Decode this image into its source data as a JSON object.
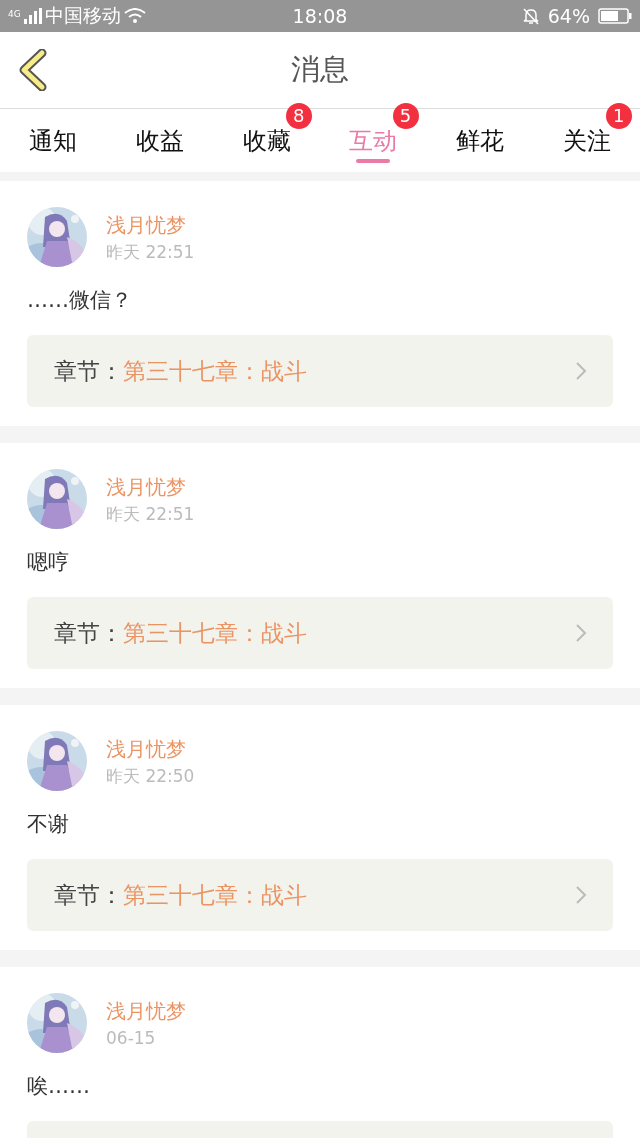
{
  "status_bar": {
    "carrier": "中国移动",
    "network": "4G",
    "time": "18:08",
    "battery": "64%"
  },
  "header": {
    "title": "消息"
  },
  "tabs": [
    {
      "label": "通知",
      "selected": false
    },
    {
      "label": "收益",
      "selected": false
    },
    {
      "label": "收藏",
      "selected": false,
      "badge": "8"
    },
    {
      "label": "互动",
      "selected": true,
      "badge": "5"
    },
    {
      "label": "鲜花",
      "selected": false
    },
    {
      "label": "关注",
      "selected": false,
      "badge": "1"
    }
  ],
  "messages": [
    {
      "user": "浅月忧梦",
      "time": "昨天 22:51",
      "text": "……微信？",
      "chapter_label": "章节：",
      "chapter": "第三十七章：战斗"
    },
    {
      "user": "浅月忧梦",
      "time": "昨天 22:51",
      "text": "嗯哼",
      "chapter_label": "章节：",
      "chapter": "第三十七章：战斗"
    },
    {
      "user": "浅月忧梦",
      "time": "昨天 22:50",
      "text": "不谢",
      "chapter_label": "章节：",
      "chapter": "第三十七章：战斗"
    },
    {
      "user": "浅月忧梦",
      "time": "06-15",
      "text": "唉……"
    }
  ]
}
